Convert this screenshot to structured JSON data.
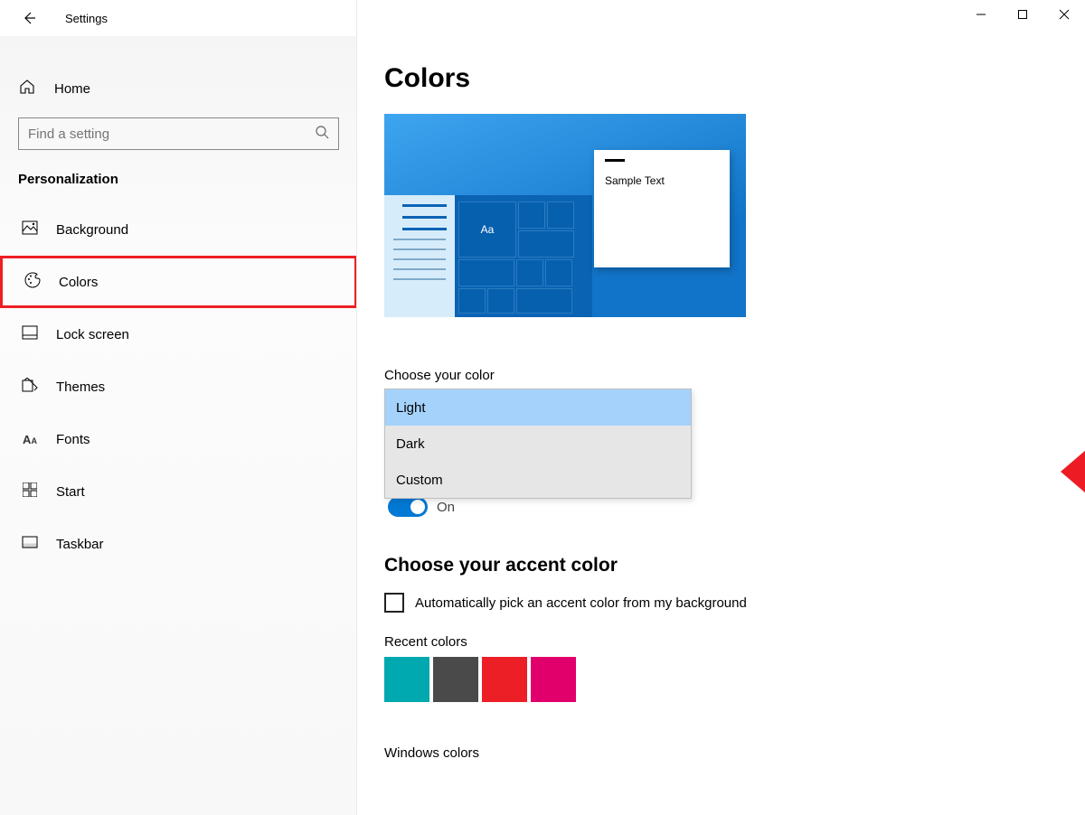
{
  "window": {
    "title": "Settings"
  },
  "sidebar": {
    "home": "Home",
    "search_placeholder": "Find a setting",
    "category": "Personalization",
    "items": [
      {
        "label": "Background"
      },
      {
        "label": "Colors"
      },
      {
        "label": "Lock screen"
      },
      {
        "label": "Themes"
      },
      {
        "label": "Fonts"
      },
      {
        "label": "Start"
      },
      {
        "label": "Taskbar"
      }
    ]
  },
  "page": {
    "title": "Colors",
    "preview": {
      "sample_text": "Sample Text",
      "aa": "Aa"
    },
    "choose_color_label": "Choose your color",
    "color_options": [
      "Light",
      "Dark",
      "Custom"
    ],
    "selected_color": "Light",
    "toggle_label": "On",
    "accent_title": "Choose your accent color",
    "auto_accent": "Automatically pick an accent color from my background",
    "recent_label": "Recent colors",
    "recent_colors": [
      "#00a8b0",
      "#4a4a4a",
      "#ec1f27",
      "#e1006b"
    ],
    "windows_colors_label": "Windows colors"
  }
}
